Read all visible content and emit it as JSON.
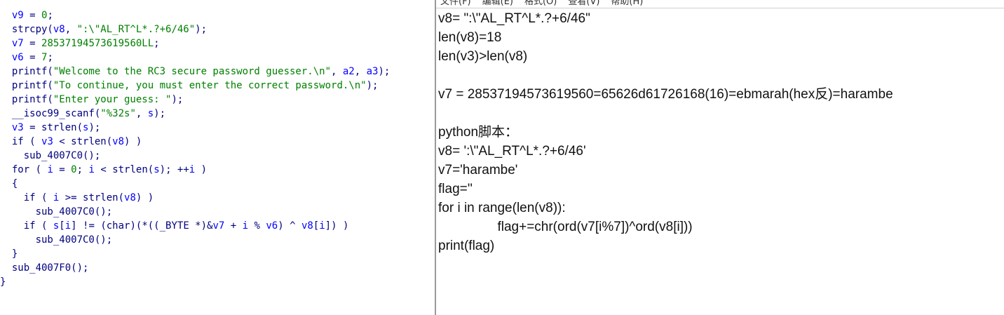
{
  "decompiler": {
    "lines": [
      [
        {
          "t": "  "
        },
        {
          "t": "v9",
          "c": "var"
        },
        {
          "t": " = "
        },
        {
          "t": "0",
          "c": "num"
        },
        {
          "t": ";"
        }
      ],
      [
        {
          "t": "  strcpy("
        },
        {
          "t": "v8",
          "c": "var"
        },
        {
          "t": ", "
        },
        {
          "t": "\":\\\"AL_RT^L*.?+6/46\"",
          "c": "str"
        },
        {
          "t": ");"
        }
      ],
      [
        {
          "t": "  "
        },
        {
          "t": "v7",
          "c": "var"
        },
        {
          "t": " = "
        },
        {
          "t": "28537194573619560LL",
          "c": "num"
        },
        {
          "t": ";"
        }
      ],
      [
        {
          "t": "  "
        },
        {
          "t": "v6",
          "c": "var"
        },
        {
          "t": " = "
        },
        {
          "t": "7",
          "c": "num"
        },
        {
          "t": ";"
        }
      ],
      [
        {
          "t": "  printf("
        },
        {
          "t": "\"Welcome to the RC3 secure password guesser.\\n\"",
          "c": "str"
        },
        {
          "t": ", "
        },
        {
          "t": "a2",
          "c": "var"
        },
        {
          "t": ", "
        },
        {
          "t": "a3",
          "c": "var"
        },
        {
          "t": ");"
        }
      ],
      [
        {
          "t": "  printf("
        },
        {
          "t": "\"To continue, you must enter the correct password.\\n\"",
          "c": "str"
        },
        {
          "t": ");"
        }
      ],
      [
        {
          "t": "  printf("
        },
        {
          "t": "\"Enter your guess: \"",
          "c": "str"
        },
        {
          "t": ");"
        }
      ],
      [
        {
          "t": "  __isoc99_scanf("
        },
        {
          "t": "\"%32s\"",
          "c": "str"
        },
        {
          "t": ", "
        },
        {
          "t": "s",
          "c": "var"
        },
        {
          "t": ");"
        }
      ],
      [
        {
          "t": "  "
        },
        {
          "t": "v3",
          "c": "var"
        },
        {
          "t": " = strlen("
        },
        {
          "t": "s",
          "c": "var"
        },
        {
          "t": ");"
        }
      ],
      [
        {
          "t": "  if ( "
        },
        {
          "t": "v3",
          "c": "var"
        },
        {
          "t": " < strlen("
        },
        {
          "t": "v8",
          "c": "var"
        },
        {
          "t": ") )"
        }
      ],
      [
        {
          "t": "    sub_4007C0();"
        }
      ],
      [
        {
          "t": "  for ( "
        },
        {
          "t": "i",
          "c": "var"
        },
        {
          "t": " = "
        },
        {
          "t": "0",
          "c": "num"
        },
        {
          "t": "; "
        },
        {
          "t": "i",
          "c": "var"
        },
        {
          "t": " < strlen("
        },
        {
          "t": "s",
          "c": "var"
        },
        {
          "t": "); ++"
        },
        {
          "t": "i",
          "c": "var"
        },
        {
          "t": " )"
        }
      ],
      [
        {
          "t": "  {"
        }
      ],
      [
        {
          "t": "    if ( "
        },
        {
          "t": "i",
          "c": "var"
        },
        {
          "t": " >= strlen("
        },
        {
          "t": "v8",
          "c": "var"
        },
        {
          "t": ") )"
        }
      ],
      [
        {
          "t": "      sub_4007C0();"
        }
      ],
      [
        {
          "t": "    if ( "
        },
        {
          "t": "s",
          "c": "var"
        },
        {
          "t": "["
        },
        {
          "t": "i",
          "c": "var"
        },
        {
          "t": "] != (char)(*((_BYTE *)&"
        },
        {
          "t": "v7",
          "c": "var"
        },
        {
          "t": " + "
        },
        {
          "t": "i",
          "c": "var"
        },
        {
          "t": " % "
        },
        {
          "t": "v6",
          "c": "var"
        },
        {
          "t": ") ^ "
        },
        {
          "t": "v8",
          "c": "var"
        },
        {
          "t": "["
        },
        {
          "t": "i",
          "c": "var"
        },
        {
          "t": "]) )"
        }
      ],
      [
        {
          "t": "      sub_4007C0();"
        }
      ],
      [
        {
          "t": "  }"
        }
      ],
      [
        {
          "t": "  sub_4007F0();"
        }
      ],
      [
        {
          "t": "}"
        }
      ]
    ]
  },
  "notepad": {
    "menu": [
      "文件(F)",
      "编辑(E)",
      "格式(O)",
      "查看(V)",
      "帮助(H)"
    ],
    "lines": [
      "v8= \":\\\"AL_RT^L*.?+6/46\"",
      "len(v8)=18",
      "len(v3)>len(v8)",
      "",
      "v7 = 28537194573619560=65626d61726168(16)=ebmarah(hex反)=harambe",
      "",
      "python脚本：",
      "v8= ':\\\"AL_RT^L*.?+6/46'",
      "v7='harambe'",
      "flag=''",
      "for i in range(len(v8)):",
      "\t\tflag+=chr(ord(v7[i%7])^ord(v8[i]))",
      "print(flag)"
    ]
  }
}
